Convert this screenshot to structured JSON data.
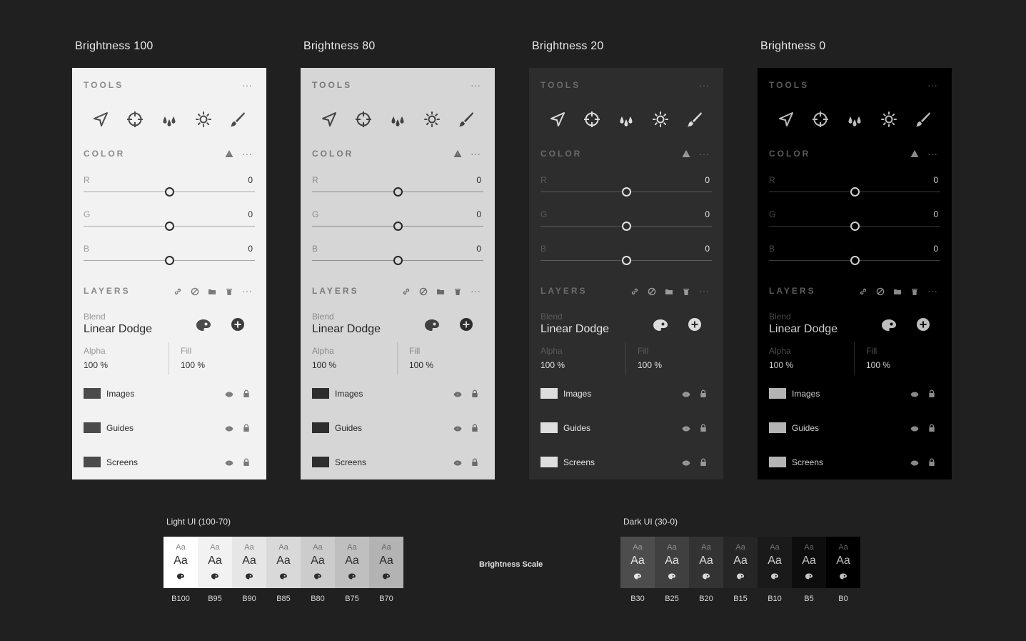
{
  "panels": [
    {
      "title": "Brightness 100",
      "theme": {
        "bg": "#f2f2f2",
        "head": "#8a8a8a",
        "label": "#9a9a9a",
        "text": "#2c2c2c",
        "icon": "#4b4b4b",
        "soft": "#7a7a7a",
        "track": "#a8a8a8",
        "knob_bg": "#f2f2f2",
        "swatch": "#4b4b4b",
        "div": "#d0d0d0",
        "fill_circle": "#3c3c3c",
        "fill_fg": "#f2f2f2"
      },
      "tools_label": "TOOLS",
      "color_label": "COLOR",
      "layers_label": "LAYERS",
      "menu": "···",
      "sliders": [
        {
          "label": "R",
          "value": "0"
        },
        {
          "label": "G",
          "value": "0"
        },
        {
          "label": "B",
          "value": "0"
        }
      ],
      "blend_label": "Blend",
      "blend_value": "Linear Dodge",
      "alpha_label": "Alpha",
      "alpha_value": "100 %",
      "fill_label": "Fill",
      "fill_value": "100 %",
      "layers": [
        "Images",
        "Guides",
        "Screens"
      ]
    },
    {
      "title": "Brightness 80",
      "theme": {
        "bg": "#d6d6d6",
        "head": "#7a7a7a",
        "label": "#8a8a8a",
        "text": "#262626",
        "icon": "#404040",
        "soft": "#6a6a6a",
        "track": "#8e8e8e",
        "knob_bg": "#d6d6d6",
        "swatch": "#2e2e2e",
        "div": "#bababa",
        "fill_circle": "#2e2e2e",
        "fill_fg": "#d6d6d6"
      },
      "tools_label": "TOOLS",
      "color_label": "COLOR",
      "layers_label": "LAYERS",
      "menu": "···",
      "sliders": [
        {
          "label": "R",
          "value": "0"
        },
        {
          "label": "G",
          "value": "0"
        },
        {
          "label": "B",
          "value": "0"
        }
      ],
      "blend_label": "Blend",
      "blend_value": "Linear Dodge",
      "alpha_label": "Alpha",
      "alpha_value": "100 %",
      "fill_label": "Fill",
      "fill_value": "100 %",
      "layers": [
        "Images",
        "Guides",
        "Screens"
      ]
    },
    {
      "title": "Brightness 20",
      "theme": {
        "bg": "#2d2d2d",
        "head": "#6a6a6a",
        "label": "#5a5a5a",
        "text": "#e4e4e4",
        "icon": "#dcdcdc",
        "soft": "#9a9a9a",
        "track": "#5a5a5a",
        "knob_bg": "#2d2d2d",
        "swatch": "#dedede",
        "div": "#444444",
        "fill_circle": "#dcdcdc",
        "fill_fg": "#2d2d2d"
      },
      "tools_label": "TOOLS",
      "color_label": "COLOR",
      "layers_label": "LAYERS",
      "menu": "···",
      "sliders": [
        {
          "label": "R",
          "value": "0"
        },
        {
          "label": "G",
          "value": "0"
        },
        {
          "label": "B",
          "value": "0"
        }
      ],
      "blend_label": "Blend",
      "blend_value": "Linear Dodge",
      "alpha_label": "Alpha",
      "alpha_value": "100 %",
      "fill_label": "Fill",
      "fill_value": "100 %",
      "layers": [
        "Images",
        "Guides",
        "Screens"
      ]
    },
    {
      "title": "Brightness 0",
      "theme": {
        "bg": "#000000",
        "head": "#5a5a5a",
        "label": "#4a4a4a",
        "text": "#cfcfcf",
        "icon": "#bdbdbd",
        "soft": "#8a8a8a",
        "track": "#3c3c3c",
        "knob_bg": "#000000",
        "swatch": "#b4b4b4",
        "div": "#2a2a2a",
        "fill_circle": "#bdbdbd",
        "fill_fg": "#000000"
      },
      "tools_label": "TOOLS",
      "color_label": "COLOR",
      "layers_label": "LAYERS",
      "menu": "···",
      "sliders": [
        {
          "label": "R",
          "value": "0"
        },
        {
          "label": "G",
          "value": "0"
        },
        {
          "label": "B",
          "value": "0"
        }
      ],
      "blend_label": "Blend",
      "blend_value": "Linear Dodge",
      "alpha_label": "Alpha",
      "alpha_value": "100 %",
      "fill_label": "Fill",
      "fill_value": "100 %",
      "layers": [
        "Images",
        "Guides",
        "Screens"
      ]
    }
  ],
  "tool_icons": [
    "navigation-arrow-icon",
    "crosshair-target-icon",
    "droplets-icon",
    "brightness-sun-icon",
    "brush-icon"
  ],
  "scale": {
    "center_label": "Brightness Scale",
    "light_label": "Light UI (100-70)",
    "dark_label": "Dark UI (30-0)",
    "sample_small": "Aa",
    "sample_large": "Aa",
    "light": [
      {
        "name": "B100",
        "bg": "#ffffff",
        "fg": "#2e2e2e",
        "sub": "#8a8a8a"
      },
      {
        "name": "B95",
        "bg": "#f2f2f2",
        "fg": "#2e2e2e",
        "sub": "#8a8a8a"
      },
      {
        "name": "B90",
        "bg": "#e6e6e6",
        "fg": "#2e2e2e",
        "sub": "#808080"
      },
      {
        "name": "B85",
        "bg": "#d9d9d9",
        "fg": "#2e2e2e",
        "sub": "#7a7a7a"
      },
      {
        "name": "B80",
        "bg": "#cccccc",
        "fg": "#2e2e2e",
        "sub": "#747474"
      },
      {
        "name": "B75",
        "bg": "#bfbfbf",
        "fg": "#2e2e2e",
        "sub": "#6e6e6e"
      },
      {
        "name": "B70",
        "bg": "#b3b3b3",
        "fg": "#2a2a2a",
        "sub": "#666666"
      }
    ],
    "dark": [
      {
        "name": "B30",
        "bg": "#4d4d4d",
        "fg": "#e6e6e6",
        "sub": "#9a9a9a"
      },
      {
        "name": "B25",
        "bg": "#404040",
        "fg": "#e0e0e0",
        "sub": "#8e8e8e"
      },
      {
        "name": "B20",
        "bg": "#333333",
        "fg": "#dadada",
        "sub": "#848484"
      },
      {
        "name": "B15",
        "bg": "#262626",
        "fg": "#d4d4d4",
        "sub": "#7a7a7a"
      },
      {
        "name": "B10",
        "bg": "#1a1a1a",
        "fg": "#cccccc",
        "sub": "#707070"
      },
      {
        "name": "B5",
        "bg": "#0d0d0d",
        "fg": "#c4c4c4",
        "sub": "#666666"
      },
      {
        "name": "B0",
        "bg": "#000000",
        "fg": "#bcbcbc",
        "sub": "#5e5e5e"
      }
    ]
  }
}
